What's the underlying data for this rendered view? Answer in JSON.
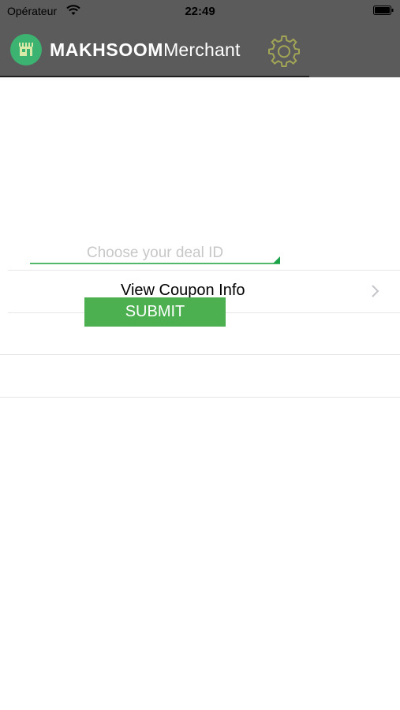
{
  "status_bar": {
    "carrier": "Opérateur",
    "time": "22:49"
  },
  "header": {
    "brand_bold": "MAKHSOOM",
    "brand_light": "Merchant",
    "settings_icon": "gear-icon",
    "logo_icon": "storefront-icon"
  },
  "form": {
    "deal_id_placeholder": "Choose your deal ID",
    "deal_id_value": "",
    "submit_label": "SUBMIT"
  },
  "list": {
    "rows": [
      {
        "label": "View Coupon Info"
      },
      {
        "label": ""
      },
      {
        "label": ""
      }
    ]
  },
  "colors": {
    "header_bg": "#5b5b5b",
    "accent_green": "#4cb050",
    "logo_green": "#3cb371",
    "gear_olive": "#a2a556"
  }
}
